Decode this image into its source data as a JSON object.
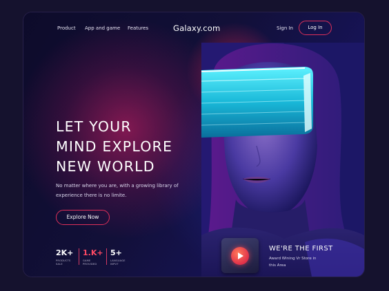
{
  "nav": {
    "links": [
      "Product",
      "App and game",
      "Features"
    ],
    "brand": "Galaxy.com",
    "signin_label": "Sign In",
    "login_label": "Log In"
  },
  "hero": {
    "headline_lines": [
      "LET YOUR",
      "MIND EXPLORE",
      "NEW WORLD"
    ],
    "subtitle": "No matter where you are, with a growing library of experience there is no limite.",
    "cta_label": "Explore Now"
  },
  "stats": [
    {
      "value": "2K+",
      "label": "PRODUCTS SALE"
    },
    {
      "value": "1.K+",
      "label": "GAME PROVIDED"
    },
    {
      "value": "5+",
      "label": "LANGUAGE INPUT"
    }
  ],
  "promo": {
    "title": "WE'RE THE FIRST",
    "description": "Award Wining Vr Store in this Area"
  },
  "colors": {
    "accent": "#e0305a",
    "background": "#0b0a22",
    "visor": "#3fe0ff"
  },
  "icons": [
    "play-icon",
    "vr-headset-photo"
  ]
}
